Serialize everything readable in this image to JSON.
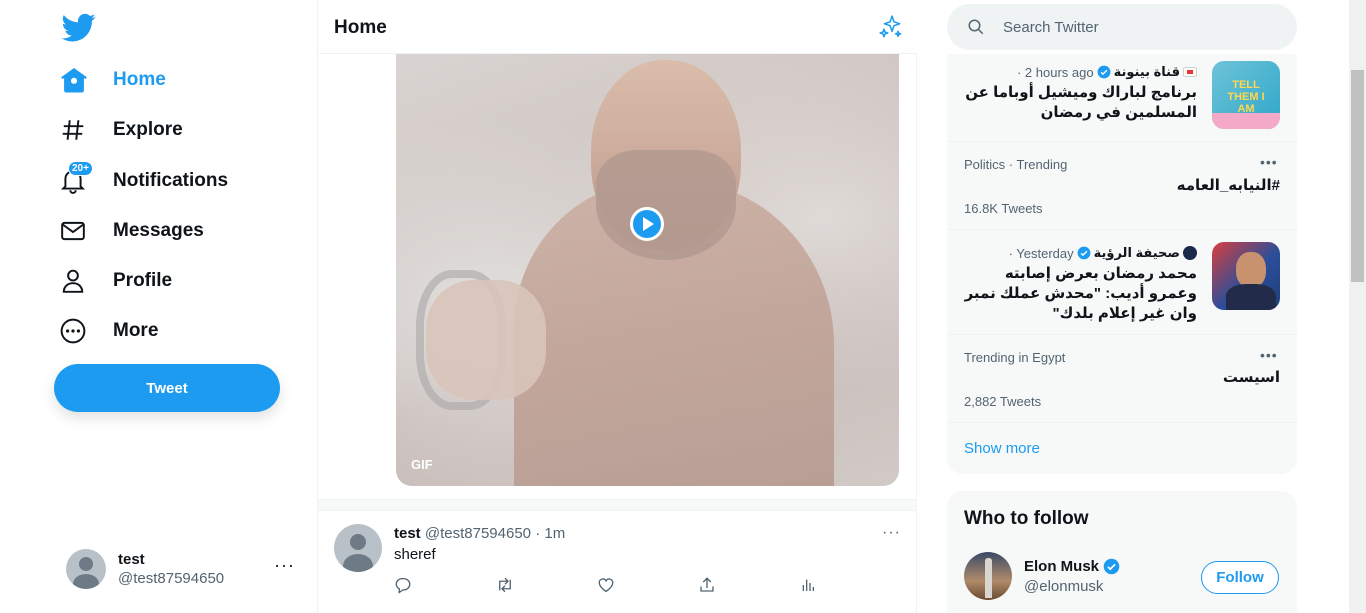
{
  "sidebar": {
    "logo_icon": "twitter-bird-icon",
    "nav": [
      {
        "label": "Home",
        "icon": "home-icon",
        "active": true
      },
      {
        "label": "Explore",
        "icon": "hashtag-icon"
      },
      {
        "label": "Notifications",
        "icon": "bell-icon",
        "badge": "20+"
      },
      {
        "label": "Messages",
        "icon": "envelope-icon"
      },
      {
        "label": "Profile",
        "icon": "person-icon"
      },
      {
        "label": "More",
        "icon": "more-circle-icon"
      }
    ],
    "tweet_button": "Tweet",
    "account": {
      "name": "test",
      "handle": "@test87594650",
      "more": "···"
    }
  },
  "main": {
    "title": "Home",
    "media": {
      "gif_label": "GIF"
    },
    "tweet": {
      "name": "test",
      "handle": "@test87594650",
      "time": "· 1m",
      "text": "sheref",
      "more": "···"
    }
  },
  "right": {
    "search_placeholder": "Search Twitter",
    "trends": [
      {
        "kind": "news",
        "source": "قناة بينونة",
        "time": "· 2 hours ago",
        "title": "برنامج لباراك وميشيل أوباما عن المسلمين في رمضان",
        "thumb_text": "TELL THEM I AM"
      },
      {
        "kind": "trend",
        "category": "Politics · Trending",
        "title": "#النيابه_العامه",
        "count": "16.8K Tweets"
      },
      {
        "kind": "news",
        "source": "صحيفة الرؤية",
        "time": "· Yesterday",
        "title": "محمد رمضان بعرض إصابته وعمرو أديب: \"محدش عملك نمبر وان غير إعلام بلدك\""
      },
      {
        "kind": "trend",
        "category": "Trending in Egypt",
        "title": "اسيست",
        "count": "2,882 Tweets"
      }
    ],
    "show_more": "Show more",
    "who_to_follow": {
      "title": "Who to follow",
      "user": {
        "name": "Elon Musk",
        "handle": "@elonmusk",
        "button": "Follow"
      }
    }
  },
  "colors": {
    "accent": "#1d9bf0",
    "text": "#0f1419",
    "secondary": "#536471",
    "panel": "#f7f9f9"
  }
}
